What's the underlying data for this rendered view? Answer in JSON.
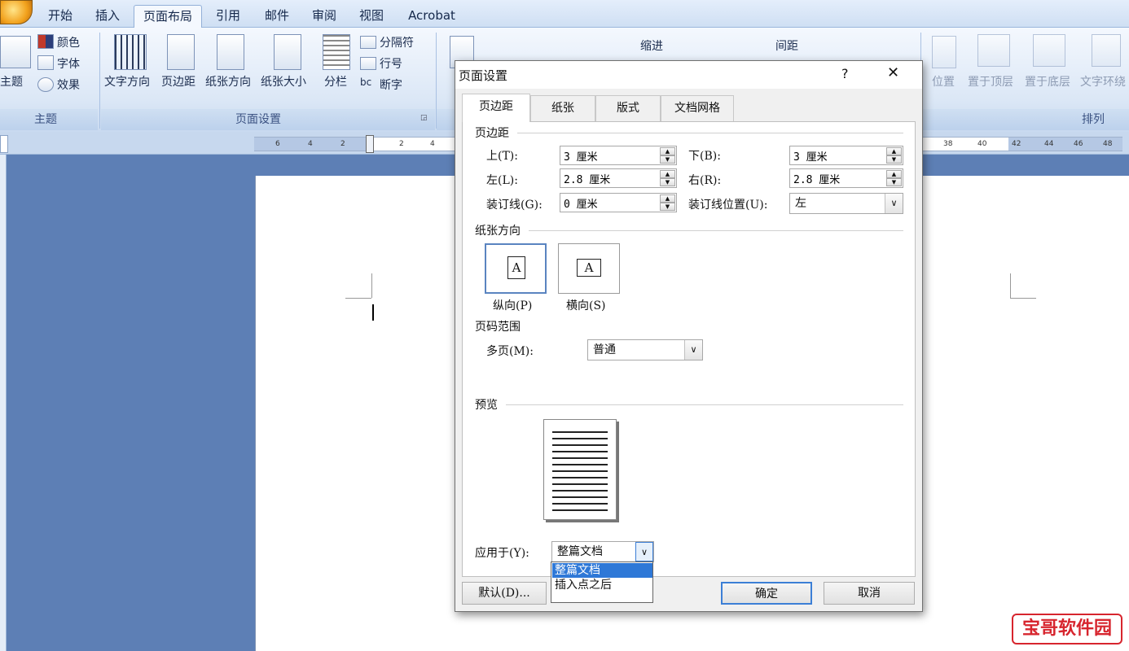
{
  "ribbon": {
    "tabs": [
      {
        "label": "开始"
      },
      {
        "label": "插入"
      },
      {
        "label": "页面布局"
      },
      {
        "label": "引用"
      },
      {
        "label": "邮件"
      },
      {
        "label": "审阅"
      },
      {
        "label": "视图"
      },
      {
        "label": "Acrobat"
      }
    ],
    "theme_group": {
      "theme_label": "主题",
      "colors": "颜色",
      "fonts": "字体",
      "effects": "效果",
      "group_label": "主题"
    },
    "page_setup_group": {
      "text_direction": "文字方向",
      "margins": "页边距",
      "orientation": "纸张方向",
      "size": "纸张大小",
      "columns": "分栏",
      "breaks": "分隔符",
      "line_numbers": "行号",
      "hyphenation": "断字",
      "group_label": "页面设置"
    },
    "paragraph_group": {
      "indent": "缩进",
      "spacing": "间距"
    },
    "arrange_group": {
      "position": "位置",
      "bring_front": "置于顶层",
      "send_back": "置于底层",
      "wrap": "文字环绕",
      "group_label": "排列"
    }
  },
  "ruler": {
    "numbers": [
      "6",
      "4",
      "2",
      "2",
      "4",
      "38",
      "40",
      "42",
      "44",
      "46",
      "48"
    ]
  },
  "dialog": {
    "title": "页面设置",
    "help": "?",
    "tabs": [
      "页边距",
      "纸张",
      "版式",
      "文档网格"
    ],
    "margins_section": "页边距",
    "top_label": "上(T):",
    "top_value": "3 厘米",
    "bottom_label": "下(B):",
    "bottom_value": "3 厘米",
    "left_label": "左(L):",
    "left_value": "2.8 厘米",
    "right_label": "右(R):",
    "right_value": "2.8 厘米",
    "gutter_label": "装订线(G):",
    "gutter_value": "0 厘米",
    "gutter_pos_label": "装订线位置(U):",
    "gutter_pos_value": "左",
    "orientation_section": "纸张方向",
    "portrait_label": "纵向(P)",
    "landscape_label": "横向(S)",
    "pages_section": "页码范围",
    "multiple_pages_label": "多页(M):",
    "multiple_pages_value": "普通",
    "preview_section": "预览",
    "apply_to_label": "应用于(Y):",
    "apply_to_value": "整篇文档",
    "apply_options": [
      "整篇文档",
      "插入点之后"
    ],
    "default_button": "默认(D)...",
    "ok_button": "确定",
    "cancel_button": "取消"
  },
  "watermark": "宝哥软件园"
}
